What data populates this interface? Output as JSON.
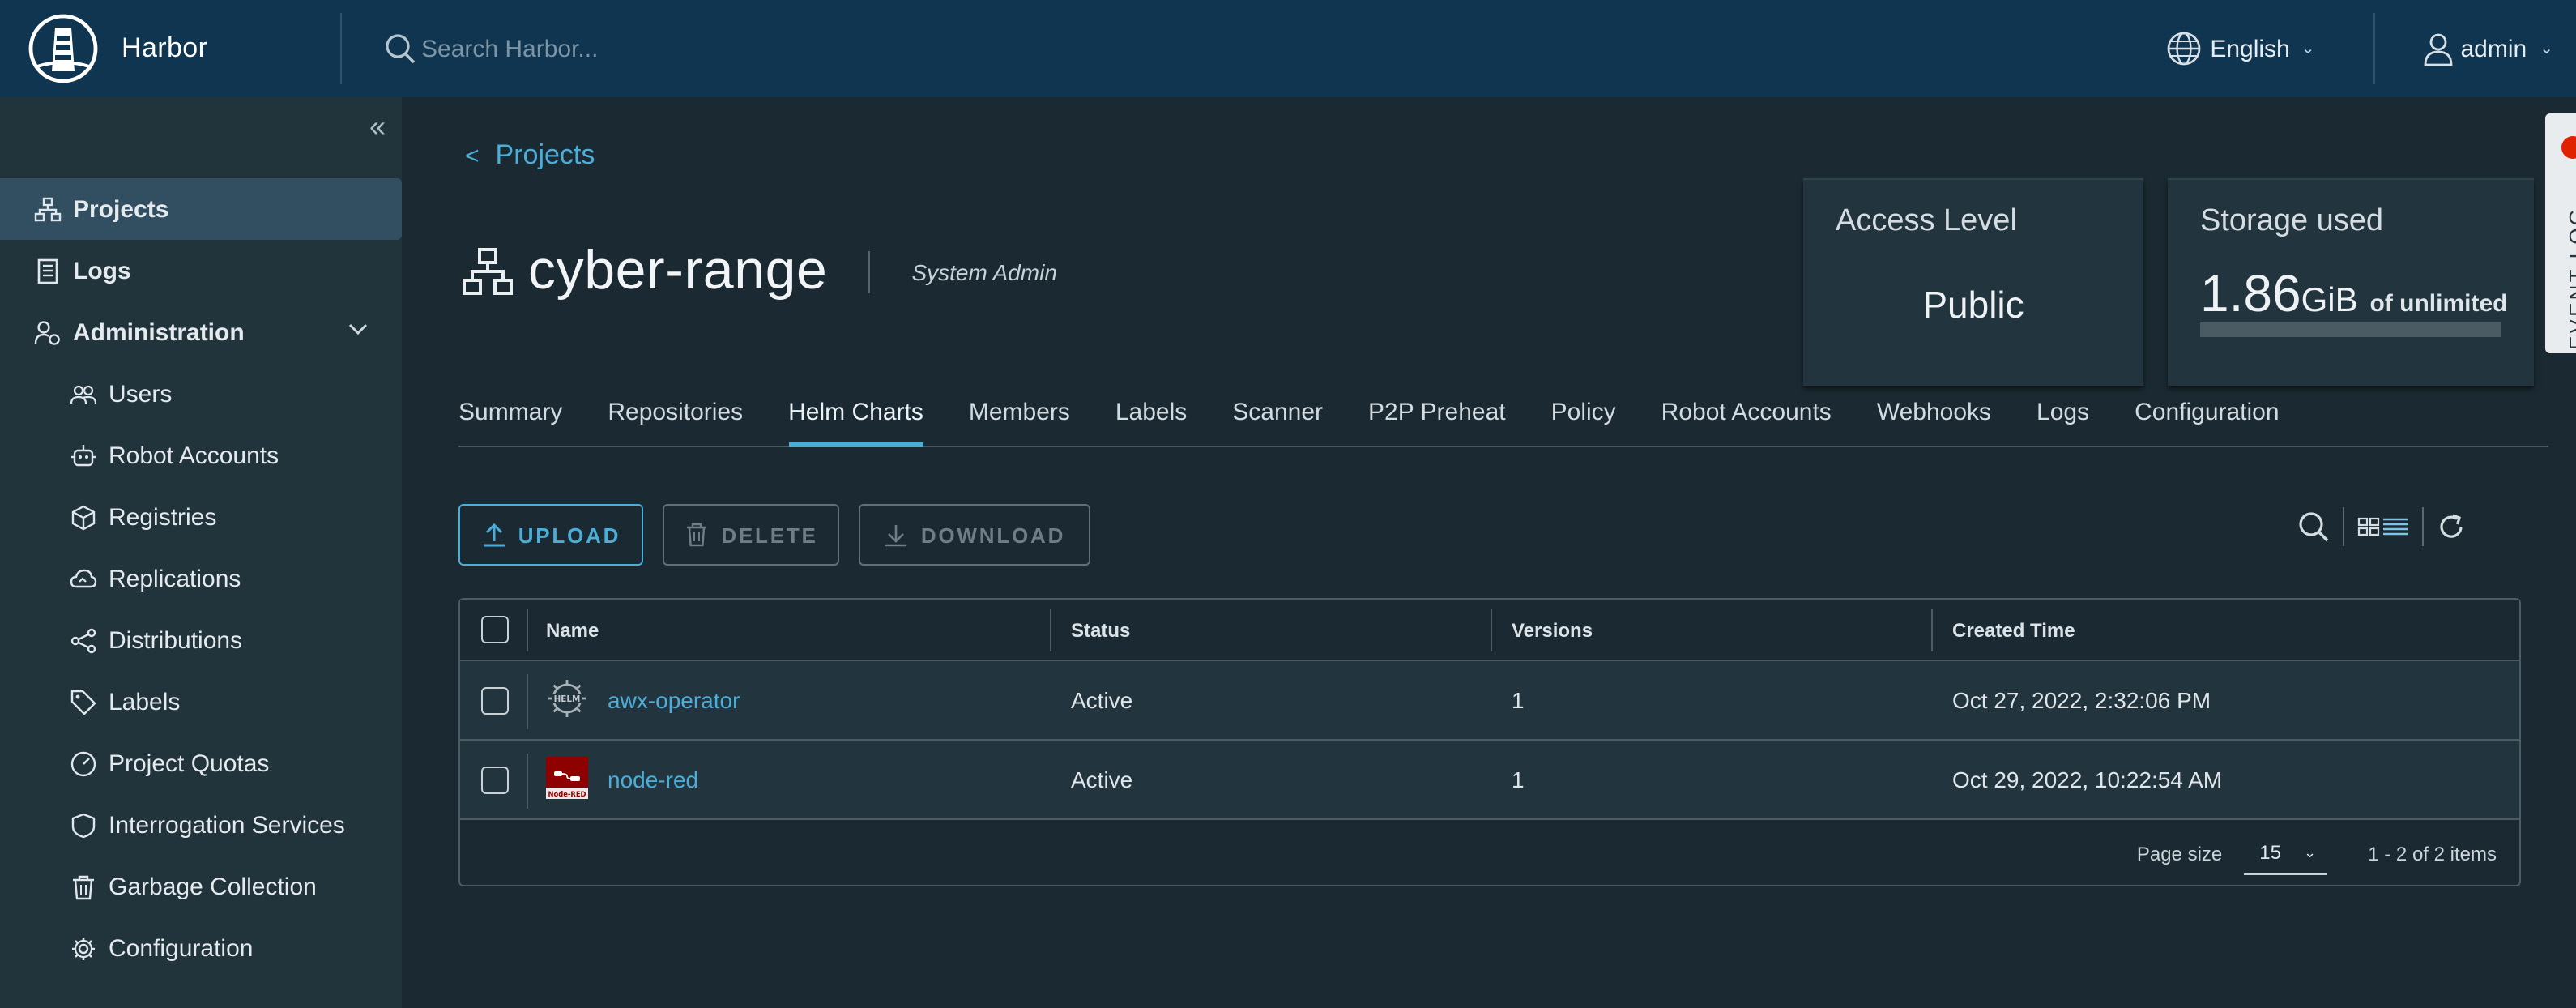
{
  "header": {
    "brand": "Harbor",
    "search_placeholder": "Search Harbor...",
    "language": "English",
    "user": "admin"
  },
  "sidebar": {
    "items": [
      {
        "label": "Projects"
      },
      {
        "label": "Logs"
      },
      {
        "label": "Administration"
      },
      {
        "label": "Users"
      },
      {
        "label": "Robot Accounts"
      },
      {
        "label": "Registries"
      },
      {
        "label": "Replications"
      },
      {
        "label": "Distributions"
      },
      {
        "label": "Labels"
      },
      {
        "label": "Project Quotas"
      },
      {
        "label": "Interrogation Services"
      },
      {
        "label": "Garbage Collection"
      },
      {
        "label": "Configuration"
      }
    ]
  },
  "breadcrumb": {
    "back_label": "Projects"
  },
  "project": {
    "name": "cyber-range",
    "role": "System Admin"
  },
  "access_card": {
    "title": "Access Level",
    "value": "Public"
  },
  "storage_card": {
    "title": "Storage used",
    "value": "1.86",
    "unit": "GiB",
    "quota_text": "of unlimited",
    "used_fraction": 0
  },
  "tabs": [
    {
      "label": "Summary"
    },
    {
      "label": "Repositories"
    },
    {
      "label": "Helm Charts"
    },
    {
      "label": "Members"
    },
    {
      "label": "Labels"
    },
    {
      "label": "Scanner"
    },
    {
      "label": "P2P Preheat"
    },
    {
      "label": "Policy"
    },
    {
      "label": "Robot Accounts"
    },
    {
      "label": "Webhooks"
    },
    {
      "label": "Logs"
    },
    {
      "label": "Configuration"
    }
  ],
  "actions": {
    "upload": "UPLOAD",
    "delete": "DELETE",
    "download": "DOWNLOAD"
  },
  "grid": {
    "columns": [
      "Name",
      "Status",
      "Versions",
      "Created Time"
    ],
    "rows": [
      {
        "name": "awx-operator",
        "status": "Active",
        "versions": "1",
        "created": "Oct 27, 2022, 2:32:06 PM",
        "icon": "helm-icon"
      },
      {
        "name": "node-red",
        "status": "Active",
        "versions": "1",
        "created": "Oct 29, 2022, 10:22:54 AM",
        "icon": "node-red-icon"
      }
    ],
    "page_size_label": "Page size",
    "page_size": "15",
    "page_info": "1 - 2 of 2 items"
  },
  "event_log": {
    "label": "EVENT LOG"
  },
  "colors": {
    "header_bg": "#0f3550",
    "sidebar_bg": "#21333b",
    "main_bg": "#1b2a32",
    "accent": "#4aaed9",
    "card_bg": "#22343d",
    "badge": "#e12200"
  }
}
